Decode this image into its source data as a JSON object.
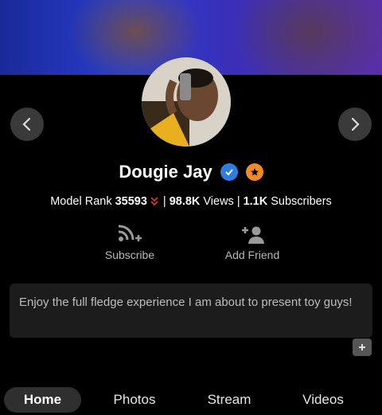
{
  "profile": {
    "name": "Dougie Jay",
    "verified_color": "#2e7de1",
    "badge_color": "#f08a24"
  },
  "stats": {
    "rank_label": "Model Rank",
    "rank_value": "35593",
    "rank_trend": "down",
    "views_value": "98.8K",
    "views_label": "Views",
    "subscribers_value": "1.1K",
    "subscribers_label": "Subscribers",
    "separator": "|"
  },
  "actions": {
    "subscribe_label": "Subscribe",
    "add_friend_label": "Add Friend"
  },
  "bio": {
    "text": "Enjoy the full fledge experience I am about to present toy guys!"
  },
  "tabs": [
    {
      "label": "Home",
      "active": true
    },
    {
      "label": "Photos",
      "active": false
    },
    {
      "label": "Stream",
      "active": false
    },
    {
      "label": "Videos",
      "active": false
    }
  ],
  "icons": {
    "prev": "chevron-left-icon",
    "next": "chevron-right-icon",
    "subscribe": "rss-plus-icon",
    "add_friend": "add-user-icon",
    "expand": "plus-icon"
  }
}
